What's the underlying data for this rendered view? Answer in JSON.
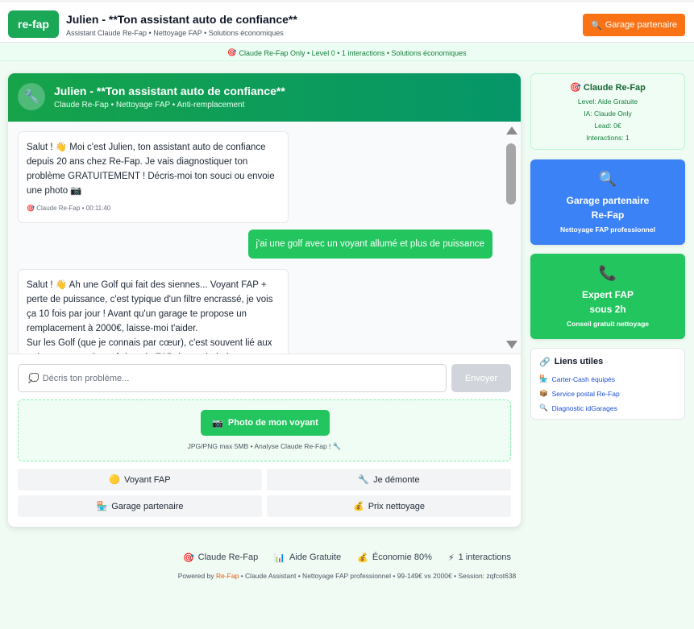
{
  "header": {
    "logo": "re-fap",
    "title": "Julien - **Ton assistant auto de confiance**",
    "subtitle": "Assistant Claude Re-Fap • Nettoyage FAP • Solutions économiques",
    "garage_button": "Garage partenaire"
  },
  "status_bar": "Claude Re-Fap Only • Level 0 • 1 interactions • Solutions économiques",
  "chat": {
    "title": "Julien - **Ton assistant auto de confiance**",
    "subtitle": "Claude Re-Fap • Nettoyage FAP • Anti-remplacement",
    "messages": [
      {
        "role": "bot",
        "text": "Salut ! 👋 Moi c'est Julien, ton assistant auto de confiance depuis 20 ans chez Re-Fap. Je vais diagnostiquer ton problème GRATUITEMENT ! Décris-moi ton souci ou envoie une photo 📷",
        "meta": "Claude Re-Fap • 00:11:40"
      },
      {
        "role": "user",
        "text": "j'ai une golf avec un voyant allumé et plus de puissance"
      },
      {
        "role": "bot",
        "text": "Salut ! 👋 Ah une Golf qui fait des siennes... Voyant FAP + perte de puissance, c'est typique d'un filtre encrassé, je vois ça 10 fois par jour ! Avant qu'un garage te propose un remplacement à 2000€, laisse-moi t'aider.\nSur les Golf (que je connais par cœur), c'est souvent lié aux trajets courts qui empêchent le FAP de se régénérer..."
      }
    ],
    "input_placeholder": "Décris ton problème...",
    "send_label": "Envoyer",
    "photo_button": "Photo de mon voyant",
    "photo_hint": "JPG/PNG max 5MB • Analyse Claude Re-Fap ! 🔧",
    "quick_actions": [
      "Voyant FAP",
      "Je démonte",
      "Garage partenaire",
      "Prix nettoyage"
    ]
  },
  "sidebar": {
    "info_title": "Claude Re-Fap",
    "info_lines": [
      "Level: Aide Gratuite",
      "IA: Claude Only",
      "Lead: 0€",
      "Interactions: 1"
    ],
    "garage_card": {
      "title_1": "Garage partenaire",
      "title_2": "Re-Fap",
      "sub": "Nettoyage FAP professionnel"
    },
    "expert_card": {
      "title_1": "Expert FAP",
      "title_2": "sous 2h",
      "sub": "Conseil gratuit nettoyage"
    },
    "links_title": "Liens utiles",
    "links": [
      "Carter-Cash équipés",
      "Service postal Re-Fap",
      "Diagnostic idGarages"
    ]
  },
  "footer": {
    "stats": [
      "Claude Re-Fap",
      "Aide Gratuite",
      "Économie 80%",
      "1 interactions"
    ],
    "powered_prefix": "Powered by",
    "powered_brand": "Re-Fap",
    "powered_suffix": "• Claude Assistant • Nettoyage FAP professionnel • 99-149€ vs 2000€ • Session: zqfcot638"
  },
  "colors": {
    "primary_green": "#16a34a",
    "accent_orange": "#f97316",
    "blue": "#3b82f6"
  }
}
